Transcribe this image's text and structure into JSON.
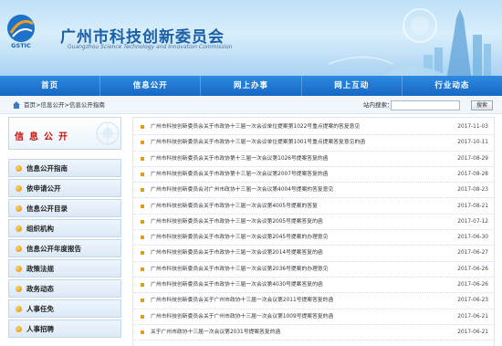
{
  "header": {
    "title": "广州市科技创新委员会",
    "subtitle": "Guangzhou Science Technology and Innovation Commission",
    "logo_text": "GSTIC"
  },
  "nav": {
    "items": [
      {
        "label": "首页"
      },
      {
        "label": "信息公开"
      },
      {
        "label": "网上办事"
      },
      {
        "label": "网上互动"
      },
      {
        "label": "行业动态"
      }
    ]
  },
  "breadcrumb": {
    "text": "首页>信息公开>信息公开指南"
  },
  "search": {
    "label": "站内搜索：",
    "placeholder": "",
    "button_label": "搜索"
  },
  "sidebar": {
    "title": "信息公开",
    "items": [
      {
        "label": "信息公开指南"
      },
      {
        "label": "依申请公开"
      },
      {
        "label": "信息公开目录"
      },
      {
        "label": "组织机构"
      },
      {
        "label": "信息公开年度报告"
      },
      {
        "label": "政策法规"
      },
      {
        "label": "政务动态"
      },
      {
        "label": "人事任免"
      },
      {
        "label": "人事招聘"
      }
    ]
  },
  "list": {
    "rows": [
      {
        "title": "广州市科技创新委员会关于市政协十三届一次会议单位提案第1022号重点提案的答复意见",
        "date": "2017-11-03"
      },
      {
        "title": "广州市科技创新委员会关于市政协十三届一次会议单位提案第1001号重点提案答复意见的函",
        "date": "2017-10-11"
      },
      {
        "title": "广州市科技创新委员会关于市政协第十三届一次会议第1026号提案答复的函",
        "date": "2017-08-29"
      },
      {
        "title": "广州市科技创新委员会关于市政协第十三届一次会议第2007号提案答复的函",
        "date": "2017-08-28"
      },
      {
        "title": "广州市科技创新委员会对广州市政协十三届一次会议第4004号提案的答复意见",
        "date": "2017-08-23"
      },
      {
        "title": "广州市科技创新委员会关于市政协十三届一次会议第4005号提案的答复",
        "date": "2017-08-21"
      },
      {
        "title": "广州市科技创新委员会关于市政协十三届一次会议第2005号提案答复的函",
        "date": "2017-07-12"
      },
      {
        "title": "广州市科技创新委员会关于市政协十三届一次会议第2045号提案的办理意见",
        "date": "2017-06-30"
      },
      {
        "title": "广州市科技创新委员会关于市政协十三届一次会议第2014号提案答复的函",
        "date": "2017-06-27"
      },
      {
        "title": "广州市科技创新委员会关于市政协十三届一次会议第2036号提案的办理意见",
        "date": "2017-06-26"
      },
      {
        "title": "广州市科技创新委员会关于市政协十三届一次会议第4030号提案答复的函",
        "date": "2017-06-26"
      },
      {
        "title": "广州市科技创新委员会关于广州市政协十三届一次会议第2011号提案答复的函",
        "date": "2017-06-23"
      },
      {
        "title": "广州市科技创新委员会关于广州市政协十三届一次会议第1009号提案答复的函",
        "date": "2017-06-21"
      },
      {
        "title": "关于广州市政协十三届一次会议第2031号提案答复的函",
        "date": "2017-06-21"
      }
    ]
  },
  "colors": {
    "nav_bg": "#1667c3",
    "title_blue": "#1b5fa8",
    "sidebar_title_red": "#c8120c",
    "bullet_orange": "#e39b1d"
  },
  "icons": {
    "home": "home-icon",
    "logo": "gstic-logo",
    "sidebar_bullet": "orange-dot-icon",
    "row_bullet": "square-bullet-icon"
  }
}
